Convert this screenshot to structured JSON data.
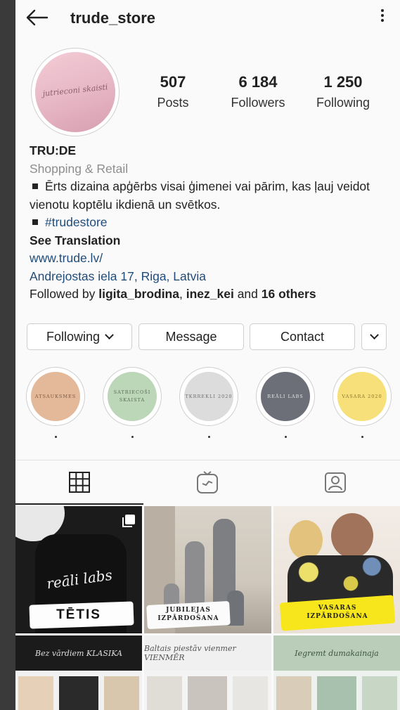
{
  "header": {
    "username": "trude_store"
  },
  "profile": {
    "avatar_text": "jutrieconi skaisti"
  },
  "stats": [
    {
      "value": "507",
      "label": "Posts"
    },
    {
      "value": "6 184",
      "label": "Followers"
    },
    {
      "value": "1 250",
      "label": "Following"
    }
  ],
  "bio": {
    "name": "TRU:DE",
    "category": "Shopping & Retail",
    "line1": "Ērts dizaina apģērbs visai ģimenei vai pārim, kas ļauj veidot vienotu koptēlu ikdienā un svētkos.",
    "hashtag": "#trudestore",
    "see_translation": "See Translation",
    "website": "www.trude.lv/",
    "address": "Andrejostas iela 17, Riga, Latvia",
    "followed_prefix": "Followed by ",
    "followed_user1": "ligita_brodina",
    "followed_sep": ", ",
    "followed_user2": "inez_kei",
    "followed_mid": " and ",
    "followed_others": "16 others"
  },
  "actions": {
    "following": "Following",
    "message": "Message",
    "contact": "Contact"
  },
  "highlights": [
    {
      "label": "ATSAUKSMES",
      "color": "#e4b999"
    },
    {
      "label": "SATRIECOŠI SKAISTA",
      "color": "#bcd7b7"
    },
    {
      "label": "TKRREKLI 2020",
      "color": "#dcdcdc"
    },
    {
      "label": "REĀLI LABS",
      "color": "#6c6f78"
    },
    {
      "label": "VASARA 2020",
      "color": "#f7e07a"
    }
  ],
  "posts": {
    "p1": {
      "script": "reāli labs",
      "label": "TĒTIS"
    },
    "p2": {
      "line1": "JUBILEJAS",
      "line2": "IZPĀRDOŠANA"
    },
    "p3": {
      "line1": "VASARAS",
      "line2": "IZPĀRDOŠANA"
    },
    "p4": {
      "caption": "Bez vārdiem KLASIKA"
    },
    "p5": {
      "caption": "Baltais piestāv vienmer VIENMĒR"
    },
    "p6": {
      "caption": "Iegremt dumakainaja"
    }
  }
}
